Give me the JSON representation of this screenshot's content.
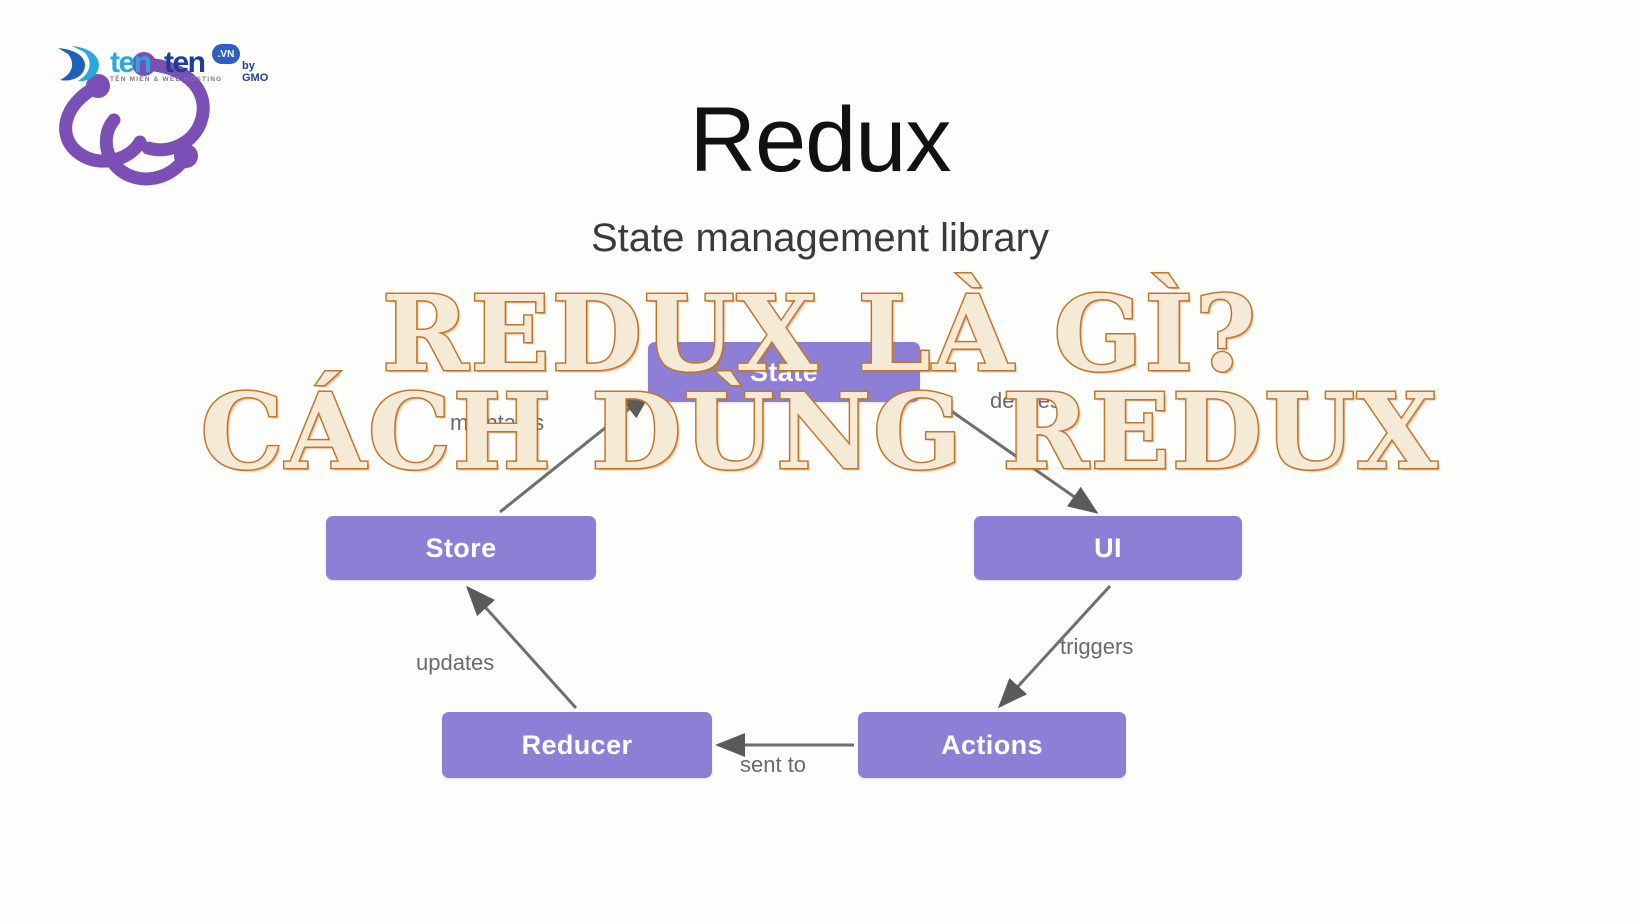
{
  "image": {
    "background_color": "#ffffff"
  },
  "diagram": {
    "title": "Redux",
    "subtitle": "State management library",
    "node_color": "#8d7fd6",
    "node_text_color": "#ffffff",
    "nodes": [
      {
        "id": "state",
        "label": "State"
      },
      {
        "id": "store",
        "label": "Store"
      },
      {
        "id": "ui",
        "label": "UI"
      },
      {
        "id": "reducer",
        "label": "Reducer"
      },
      {
        "id": "actions",
        "label": "Actions"
      }
    ],
    "edges": [
      {
        "from": "store",
        "to": "state",
        "label": "maintains"
      },
      {
        "from": "state",
        "to": "ui",
        "label": "defines"
      },
      {
        "from": "ui",
        "to": "actions",
        "label": "triggers"
      },
      {
        "from": "actions",
        "to": "reducer",
        "label": "sent to"
      },
      {
        "from": "reducer",
        "to": "store",
        "label": "updates"
      }
    ],
    "edge_label_color": "#6a6a6a",
    "arrow_color": "#5a5a5a"
  },
  "logo": {
    "brand_part1": "ten",
    "brand_part2": "ten",
    "tld_badge": ".VN",
    "by_line": "by GMO",
    "tagline": "TÊN MIỀN & WEB HOSTING",
    "brand_color_1": "#29a8e0",
    "brand_color_2": "#1c3f94",
    "redux_logo_color": "#7b4fb5"
  },
  "headline": {
    "line1": "REDUX LÀ GÌ?",
    "line2": "CÁCH DÙNG REDUX",
    "fill_color": "#f4ead6",
    "outline_color": "#c2762b"
  }
}
